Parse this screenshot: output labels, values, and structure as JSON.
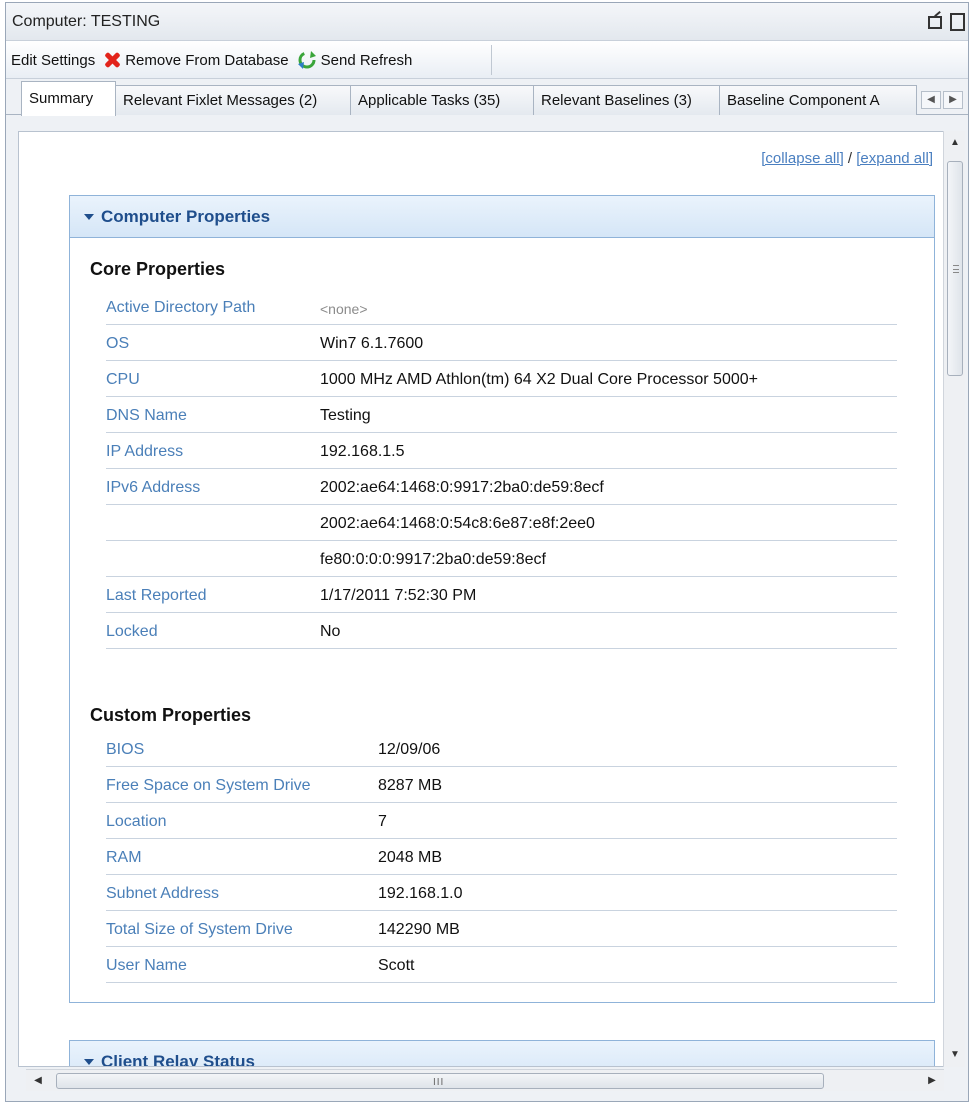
{
  "window": {
    "title": "Computer: TESTING"
  },
  "toolbar": {
    "edit_settings": "Edit Settings",
    "remove_from_database": "Remove From Database",
    "send_refresh": "Send Refresh"
  },
  "tabs": [
    {
      "label": "Summary"
    },
    {
      "label": "Relevant Fixlet Messages (2)"
    },
    {
      "label": "Applicable Tasks (35)"
    },
    {
      "label": "Relevant Baselines (3)"
    },
    {
      "label": "Baseline Component A"
    }
  ],
  "links": {
    "collapse_all": "[collapse all]",
    "separator": " / ",
    "expand_all": "[expand all]"
  },
  "computer_properties": {
    "header": "Computer Properties",
    "core": {
      "title": "Core Properties",
      "rows": [
        {
          "label": "Active Directory Path",
          "value": "<none>"
        },
        {
          "label": "OS",
          "value": "Win7 6.1.7600"
        },
        {
          "label": "CPU",
          "value": "1000 MHz AMD Athlon(tm) 64 X2 Dual Core Processor 5000+"
        },
        {
          "label": "DNS Name",
          "value": "Testing"
        },
        {
          "label": "IP Address",
          "value": "192.168.1.5"
        },
        {
          "label": "IPv6 Address",
          "value": "2002:ae64:1468:0:9917:2ba0:de59:8ecf"
        },
        {
          "label": "",
          "value": "2002:ae64:1468:0:54c8:6e87:e8f:2ee0"
        },
        {
          "label": "",
          "value": "fe80:0:0:0:9917:2ba0:de59:8ecf"
        },
        {
          "label": "Last Reported",
          "value": "1/17/2011 7:52:30 PM"
        },
        {
          "label": "Locked",
          "value": "No"
        }
      ]
    },
    "custom": {
      "title": "Custom Properties",
      "rows": [
        {
          "label": "BIOS",
          "value": "12/09/06"
        },
        {
          "label": "Free Space on System Drive",
          "value": "8287 MB"
        },
        {
          "label": "Location",
          "value": "7"
        },
        {
          "label": "RAM",
          "value": "2048 MB"
        },
        {
          "label": "Subnet Address",
          "value": "192.168.1.0"
        },
        {
          "label": "Total Size of System Drive",
          "value": "142290 MB"
        },
        {
          "label": "User Name",
          "value": "Scott"
        }
      ]
    }
  },
  "client_relay_status": {
    "header": "Client Relay Status"
  },
  "scrollbar": {
    "grip": "III"
  }
}
